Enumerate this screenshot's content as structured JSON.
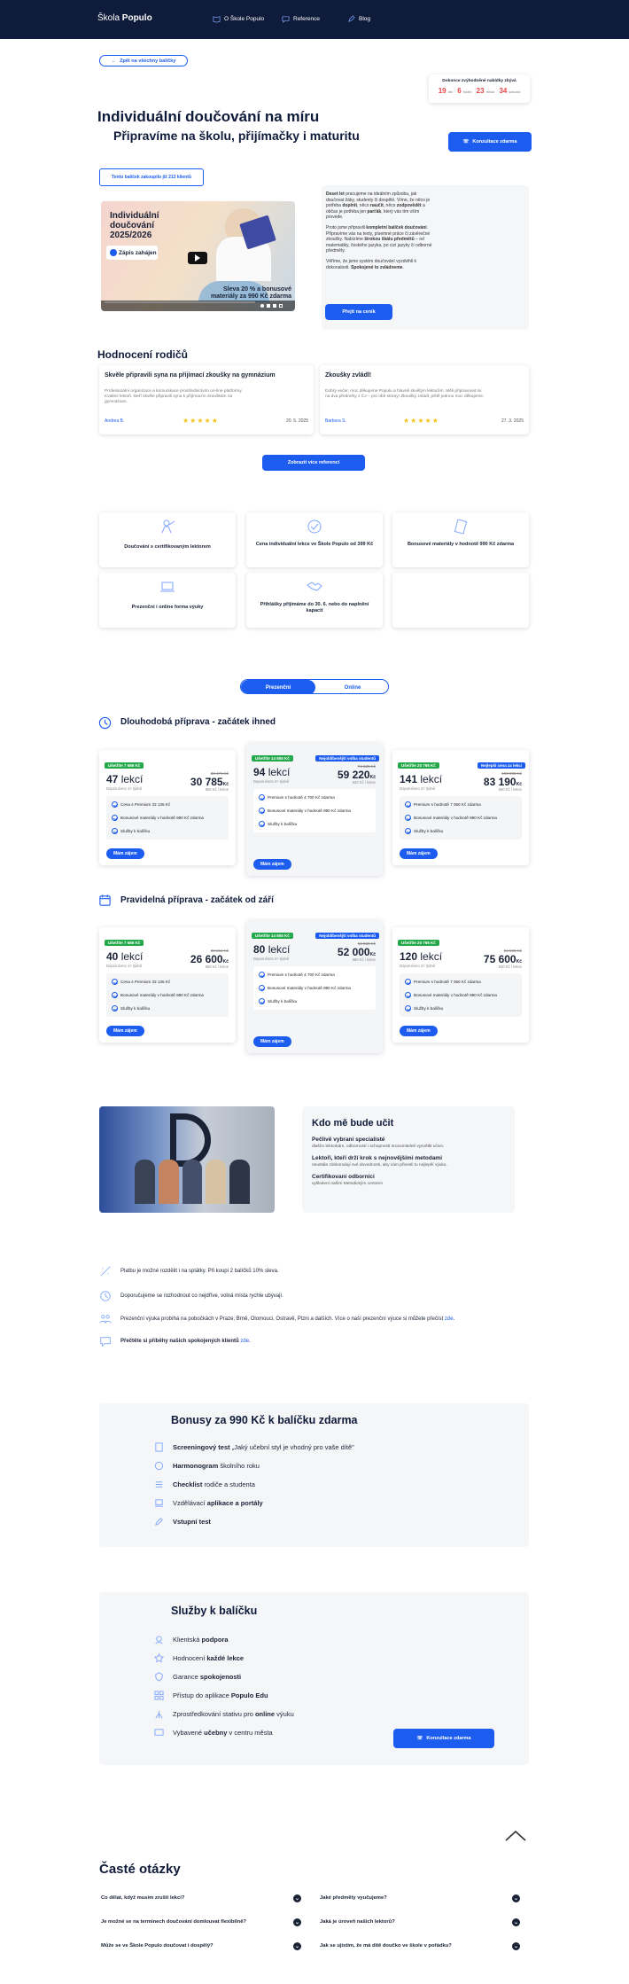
{
  "nav": {
    "logo_a": "Škola ",
    "logo_b": "Populo",
    "links": [
      "O Škole Populo",
      "Reference",
      "Blog"
    ]
  },
  "back": "Zpět na všechny balíčky",
  "deadline": {
    "title": "Dokonce zvýhodněné nabídky zbývá",
    "d": "19",
    "dl": "dní",
    "h": "6",
    "hl": "hodin",
    "m": "23",
    "ml": "minut",
    "s": "34",
    "sl": "sekund"
  },
  "hero": {
    "title": "Individuální doučování na míru",
    "subtitle": "Připravíme  na školu, přijímačky i maturitu",
    "cta": "Konzultace zdarma",
    "bought": "Tento balíček zakoupilo již 213 klientů"
  },
  "video": {
    "title": "Individuální doučování 2025/2026",
    "enroll": "Zápis zahájen",
    "promo": "Sleva 20 % a bonusové materiály za 990 Kč zdarma"
  },
  "intro": {
    "p1a": "Deset let",
    "p1b": " pracujeme na ideálním způsobu, jak doučovat žáky, studenty či dospělé. Víme, že něco je potřeba ",
    "p1c": "doplnit",
    "p1d": ", něco ",
    "p1e": "naučit",
    "p1f": ", něco ",
    "p1g": "zodpovědět",
    "p1h": " a občas je potřeba jen ",
    "p1i": "parťák",
    "p1j": ", který vás tím vším provede.",
    "p2a": "Proto jsme připravili ",
    "p2b": "kompletní balíček doučování",
    "p2c": ". Připravíme vás na testy, písemné práce či závěrečné zkoušky. Nabízíme ",
    "p2d": "širokou škálu předmětů",
    "p2e": " – od matematiky, českého jazyka, po cizí jazyky či odborné předměty.",
    "p3a": "Věříme, že jsme systém doučování vyzdvihli k dokonalosti. ",
    "p3b": "Spokojené to zvládneme",
    "p3c": ".",
    "btn": "Přejít na ceník"
  },
  "reviews": {
    "heading": "Hodnocení rodičů",
    "items": [
      {
        "title": "Skvěle připravili syna na přijímací zkoušky na gymnázium",
        "text": "Profesionální organizace a komunikace prostřednictvím on-line platformy. Kvalitní lektoři, kteří skvěle připravili syna k přijímacím zkouškám na gymnázium.",
        "author": "Andrea B.",
        "date": "20. 5. 2025"
      },
      {
        "title": "Zkoušky zvládl!",
        "text": "Dobrý večer, moc děkujeme Populu a hlavně skvělým lektorům. Měli připravovat mi na dva předměty z ČJ – pro obě strany! Zkoušky zvládl, ještě jednou moc děkujeme.",
        "author": "Barbora S.",
        "date": "27. 3. 2025"
      }
    ],
    "more": "Zobrazit více referencí"
  },
  "features": [
    "Doučování s certifikovaným lektorem",
    "Cena individuální lekce ve Škole Populo od 399 Kč",
    "Bonusové materiály v hodnotě 990 Kč zdarma",
    "Prezenční i online forma výuky",
    "Přihlášky přijímáme do 30. 6. nebo do naplnění kapacit",
    ""
  ],
  "toggle": {
    "a": "Prezenční",
    "b": "Online"
  },
  "plans": [
    {
      "title": "Dlouhodobá příprava - začátek ihned",
      "cards": [
        {
          "save": "Ušetříte 7 686 Kč",
          "badge": "",
          "lessons": "47",
          "lessons_unit": "lekcí",
          "sub": "Doporučeno 1× týdně",
          "old": "38 471 Kč",
          "price": "30 785",
          "pcur": "Kč",
          "per": "655 Kč / lekce",
          "f": [
            "Cena s Premium 33 135 Kč",
            "Bonusové materiály v hodnotě 990 Kč zdarma",
            "Služby k balíčku"
          ],
          "btn": "Mám zájem"
        },
        {
          "save": "Ušetříte 14 805 Kč",
          "badge": "Nejoblíbenější volba studentů",
          "lessons": "94",
          "lessons_unit": "lekcí",
          "sub": "Doporučeno 2× týdně",
          "old": "74 025 Kč",
          "price": "59 220",
          "pcur": "Kč",
          "per": "630 Kč / lekce",
          "f": [
            "Premium s hodnotě 4 700 Kč zdarma",
            "Bonusové materiály v hodnotě 990 Kč zdarma",
            "Služby k balíčku"
          ],
          "btn": "Mám zájem"
        },
        {
          "save": "Ušetříte 20 798 Kč",
          "badge": "Nejlepší cena za lekci",
          "lessons": "141",
          "lessons_unit": "lekcí",
          "sub": "Doporučeno 3× týdně",
          "old": "103 988 Kč",
          "price": "83 190",
          "pcur": "Kč",
          "per": "590 Kč / lekce",
          "f": [
            "Premium s hodnotě 7 050 Kč zdarma",
            "Bonusové materiály v hodnotě 990 Kč zdarma",
            "Služby k balíčku"
          ],
          "btn": "Mám zájem"
        }
      ]
    },
    {
      "title": "Pravidelná příprava - začátek od září",
      "cards": [
        {
          "save": "Ušetříte 7 686 Kč",
          "badge": "",
          "lessons": "40",
          "lessons_unit": "lekcí",
          "sub": "Doporučeno 1× týdně",
          "old": "33 264 Kč",
          "price": "26 600",
          "pcur": "Kč",
          "per": "665 Kč / lekce",
          "f": [
            "Cena s Premium 33 135 Kč",
            "Bonusové materiály v hodnotě 990 Kč zdarma",
            "Služby k balíčku"
          ],
          "btn": "Mám zájem"
        },
        {
          "save": "Ušetříte 14 805 Kč",
          "badge": "Nejoblíbenější volba studentů",
          "lessons": "80",
          "lessons_unit": "lekcí",
          "sub": "Doporučeno 2× týdně",
          "old": "66 500 Kč",
          "price": "52 000",
          "pcur": "Kč",
          "per": "650 Kč / lekce",
          "f": [
            "Premium s hodnotě 4 700 Kč zdarma",
            "Bonusové materiály v hodnotě 990 Kč zdarma",
            "Služby k balíčku"
          ],
          "btn": "Mám zájem"
        },
        {
          "save": "Ušetříte 20 798 Kč",
          "badge": "",
          "lessons": "120",
          "lessons_unit": "lekcí",
          "sub": "Doporučeno 3× týdně",
          "old": "94 500 Kč",
          "price": "75 600",
          "pcur": "Kč",
          "per": "630 Kč / lekce",
          "f": [
            "Premium s hodnotě 7 050 Kč zdarma",
            "Bonusové materiály v hodnotě 990 Kč zdarma",
            "Služby k balíčku"
          ],
          "btn": "Mám zájem"
        }
      ]
    }
  ],
  "teachers": {
    "heading": "Kdo mě bude učit",
    "items": [
      {
        "t": "Pečlivě vybraní specialisté",
        "d": "dlaším lektorkám, odborností i schopností srozumitelně vysvětlit učivo."
      },
      {
        "t": "Lektoři, kteří drží krok s nejnovějšími metodami",
        "d": "neustále zdokonalují své dovednosti, aby vám přinesli tu nejlepší výuku."
      },
      {
        "t": "Certifikovaní odborníci",
        "d": "vyškolení naším Metodickým centrem"
      }
    ]
  },
  "info": {
    "r1": "Platbu je možné rozdělit i na splátky. Při koupi 2 balíčků 10% sleva.",
    "r2": "Doporučujeme se rozhodnout co nejdříve, volná místa rychle ubývají.",
    "r3a": "Prezenční výuka probíhá na pobočkách v Praze, Brně, Olomouci, Ostravě, Plzni a dalších. Více o naší prezenční výuce si můžete přečíst ",
    "r3b": "zde",
    "r3c": ".",
    "r4a": "Přečtěte si příběhy našich spokojených klientů ",
    "r4b": "zde",
    "r4c": "."
  },
  "bonus": {
    "heading": "Bonusy za 990 Kč k balíčku zdarma",
    "items": [
      {
        "b": "Screeningový test",
        "r": " „Jaký učební styl je vhodný pro vaše dítě\"",
        "pre": ""
      },
      {
        "b": "Harmonogram",
        "r": " školního roku",
        "pre": ""
      },
      {
        "b": "Checklist",
        "r": " rodiče a studenta",
        "pre": ""
      },
      {
        "pre": "Vzdělávací ",
        "b": "aplikace a portály",
        "r": ""
      },
      {
        "b": "Vstupní test",
        "r": "",
        "pre": ""
      }
    ]
  },
  "services": {
    "heading": "Služby k balíčku",
    "items": [
      {
        "pre": "Klientská ",
        "b": "podpora",
        "r": ""
      },
      {
        "pre": "Hodnocení ",
        "b": "každé lekce",
        "r": ""
      },
      {
        "pre": "Garance ",
        "b": "spokojenosti",
        "r": ""
      },
      {
        "pre": "Přístup do aplikace ",
        "b": "Populo Edu",
        "r": ""
      },
      {
        "pre": "Zprostředkování stativu pro ",
        "b": "online",
        "r": " výuku"
      },
      {
        "pre": "Vybavené ",
        "b": "učebny",
        "r": " v centru města"
      }
    ],
    "cta": "Konzultace zdarma"
  },
  "faq": {
    "heading": "Časté otázky",
    "items": [
      "Co dělat, když musím zrušit lekci?",
      "Jaké předměty vyučujeme?",
      "Je možné se na termínech doučování domlouvat flexibilně?",
      "Jaká je úroveň našich lektorů?",
      "Může se ve Škole Populo doučovat i dospělý?",
      "Jak se ujistím, že má dítě doučko ve škole v pořádku?"
    ]
  },
  "colors": {
    "navy": "#0f1b3a",
    "blue": "#1c5df0",
    "green": "#23a84a",
    "red": "#e54848"
  }
}
